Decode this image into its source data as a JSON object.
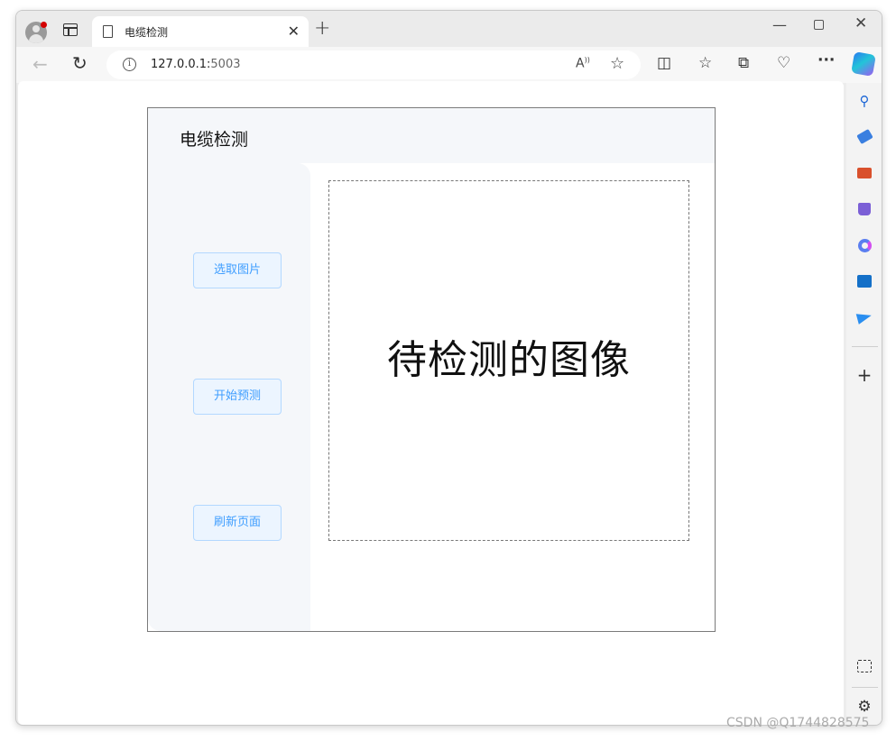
{
  "browser": {
    "tab_title": "电缆检测",
    "tab_close": "✕",
    "new_tab": "+",
    "url_host": "127.0.0.1:",
    "url_port": "5003",
    "window_controls": {
      "minimize": "—",
      "close": "✕"
    },
    "toolbar_icons": [
      "split-screen-icon",
      "favorites-icon",
      "collections-icon",
      "browser-essentials-icon",
      "more-icon"
    ],
    "sidebar_icons": [
      "search-icon",
      "shopping-icon",
      "tools-icon",
      "games-icon",
      "office-icon",
      "outlook-icon",
      "telegram-icon"
    ]
  },
  "app": {
    "title": "电缆检测",
    "buttons": {
      "select_image": "选取图片",
      "start_predict": "开始预测",
      "refresh_page": "刷新页面"
    },
    "image_placeholder": "待检测的图像"
  },
  "watermark": "CSDN @Q1744828575",
  "colors": {
    "button_bg": "#ecf5ff",
    "button_border": "#b3d8ff",
    "button_text": "#409eff",
    "aside_bg": "#f5f7fa"
  }
}
